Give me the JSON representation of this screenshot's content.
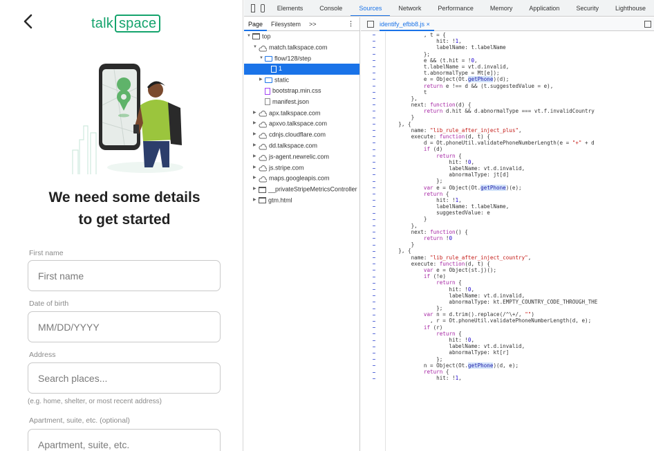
{
  "app": {
    "logo_prefix": "talk",
    "logo_box": "space",
    "heading_line1": "We need some details",
    "heading_line2": "to get started",
    "fields": [
      {
        "label": "First name",
        "placeholder": "First name"
      },
      {
        "label": "Date of birth",
        "placeholder": "MM/DD/YYYY"
      },
      {
        "label": "Address",
        "placeholder": "Search places..."
      },
      {
        "label": "Apartment, suite, etc. (optional)",
        "placeholder": "Apartment, suite, etc."
      }
    ],
    "address_hint": "(e.g. home, shelter, or most recent address)",
    "accent_color": "#14a36c"
  },
  "devtools": {
    "tabs": [
      "Elements",
      "Console",
      "Sources",
      "Network",
      "Performance",
      "Memory",
      "Application",
      "Security",
      "Lighthouse"
    ],
    "active_tab": "Sources",
    "nav_tabs": [
      "Page",
      "Filesystem"
    ],
    "nav_more": ">>",
    "tree": [
      {
        "label": "top",
        "indent": 0,
        "icon": "frame",
        "arrow": "open"
      },
      {
        "label": "match.talkspace.com",
        "indent": 1,
        "icon": "cloud",
        "arrow": "open"
      },
      {
        "label": "flow/128/step",
        "indent": 2,
        "icon": "folder",
        "arrow": "open"
      },
      {
        "label": "1",
        "indent": 3,
        "icon": "doc",
        "arrow": "none",
        "selected": true
      },
      {
        "label": "static",
        "indent": 2,
        "icon": "folder",
        "arrow": "closed"
      },
      {
        "label": "bootstrap.min.css",
        "indent": 2,
        "icon": "doc-purple",
        "arrow": "none"
      },
      {
        "label": "manifest.json",
        "indent": 2,
        "icon": "doc",
        "arrow": "none"
      },
      {
        "label": "apx.talkspace.com",
        "indent": 1,
        "icon": "cloud",
        "arrow": "closed"
      },
      {
        "label": "apxvo.talkspace.com",
        "indent": 1,
        "icon": "cloud",
        "arrow": "closed"
      },
      {
        "label": "cdnjs.cloudflare.com",
        "indent": 1,
        "icon": "cloud",
        "arrow": "closed"
      },
      {
        "label": "dd.talkspace.com",
        "indent": 1,
        "icon": "cloud",
        "arrow": "closed"
      },
      {
        "label": "js-agent.newrelic.com",
        "indent": 1,
        "icon": "cloud",
        "arrow": "closed"
      },
      {
        "label": "js.stripe.com",
        "indent": 1,
        "icon": "cloud",
        "arrow": "closed"
      },
      {
        "label": "maps.googleapis.com",
        "indent": 1,
        "icon": "cloud",
        "arrow": "closed"
      },
      {
        "label": "__privateStripeMetricsController",
        "indent": 1,
        "icon": "frame",
        "arrow": "closed"
      },
      {
        "label": "gtm.html",
        "indent": 1,
        "icon": "frame",
        "arrow": "closed"
      }
    ],
    "file_tab": "identify_efbb8.js",
    "code": [
      "            , t = {",
      "                hit: !1,",
      "                labelName: t.labelName",
      "            };",
      "            e && (t.hit = !0,",
      "            t.labelName = vt.d.invalid,",
      "            t.abnormalType = Mt[e]);",
      "            e = Object(Ot.getPhone)(d);",
      "            return e !== d && (t.suggestedValue = e),",
      "            t",
      "        },",
      "        next: function(d) {",
      "            return d.hit && d.abnormalType === vt.f.invalidCountry",
      "        }",
      "    }, {",
      "        name: \"lib_rule_after_inject_plus\",",
      "        execute: function(d, t) {",
      "            d = Ot.phoneUtil.validatePhoneNumberLength(e = \"+\" + d",
      "            if (d)",
      "                return {",
      "                    hit: !0,",
      "                    labelName: vt.d.invalid,",
      "                    abnormalType: jt[d]",
      "                };",
      "            var e = Object(Ot.getPhone)(e);",
      "            return {",
      "                hit: !1,",
      "                labelName: t.labelName,",
      "                suggestedValue: e",
      "            }",
      "        },",
      "        next: function() {",
      "            return !0",
      "        }",
      "    }, {",
      "        name: \"lib_rule_after_inject_country\",",
      "        execute: function(d, t) {",
      "            var e = Object(st.j)();",
      "            if (!e)",
      "                return {",
      "                    hit: !0,",
      "                    labelName: vt.d.invalid,",
      "                    abnormalType: kt.EMPTY_COUNTRY_CODE_THROUGH_THE",
      "                };",
      "            var n = d.trim().replace(/^\\+/, \"\")",
      "              , r = Ot.phoneUtil.validatePhoneNumberLength(d, e);",
      "            if (r)",
      "                return {",
      "                    hit: !0,",
      "                    labelName: vt.d.invalid,",
      "                    abnormalType: kt[r]",
      "                };",
      "            n = Object(Ot.getPhone)(d, e);",
      "            return {",
      "                hit: !1,"
    ]
  }
}
